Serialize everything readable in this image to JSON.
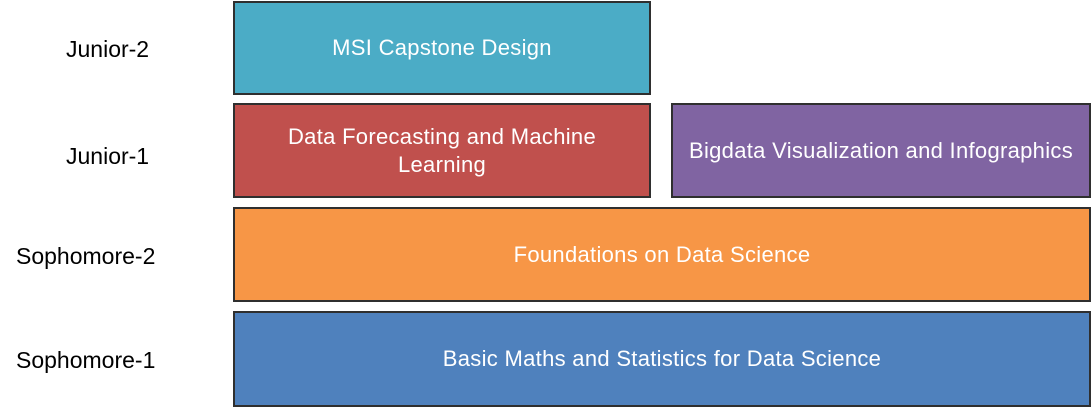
{
  "levels": {
    "junior_2": "Junior-2",
    "junior_1": "Junior-1",
    "sophomore_2": "Sophomore-2",
    "sophomore_1": "Sophomore-1"
  },
  "courses": {
    "msi_capstone": {
      "title": "MSI Capstone Design",
      "color": "#4BACC6"
    },
    "data_forecasting": {
      "title": "Data Forecasting and Machine Learning",
      "color": "#C0504D"
    },
    "bigdata_visualization": {
      "title": "Bigdata Visualization and Infographics",
      "color": "#8064A2"
    },
    "foundations": {
      "title": "Foundations on Data Science",
      "color": "#F79646"
    },
    "basic_maths": {
      "title": "Basic Maths and Statistics for Data Science",
      "color": "#4F81BD"
    }
  }
}
